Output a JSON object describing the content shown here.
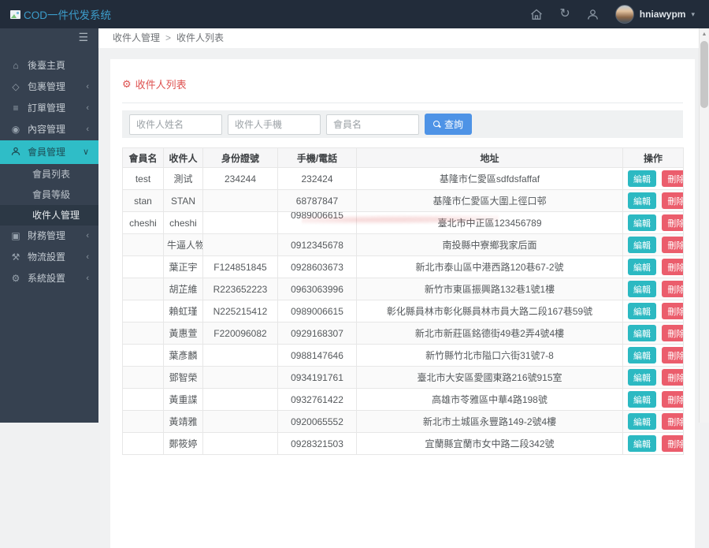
{
  "icons": {
    "hamburger": "☰",
    "home": "⌂",
    "gem": "◇",
    "layers": "≡",
    "ball": "◉",
    "money": "▣",
    "wrench": "⚒",
    "gear": "⚙",
    "chevron_left": "‹",
    "chevron_down": "∨",
    "caret_down": "▾",
    "refresh": "↻",
    "scroll_up": "▲",
    "title_gear": "⚙"
  },
  "colors": {
    "topbar_bg": "#222c3a",
    "sidebar_bg": "#364150",
    "active_item_bg": "#2fbdc7",
    "logo_text": "#3c9dcb",
    "title_red": "#de5250",
    "search_btn_blue": "#4e93e6",
    "edit_btn": "#2cb9c2",
    "delete_btn": "#eb5d6c"
  },
  "header": {
    "logo_text": "COD一件代发系统",
    "username": "hniawypm"
  },
  "sidebar": {
    "items": [
      {
        "label": "後臺主頁",
        "arrow": ""
      },
      {
        "label": "包裹管理",
        "arrow": "‹"
      },
      {
        "label": "訂單管理",
        "arrow": "‹"
      },
      {
        "label": "內容管理",
        "arrow": "‹"
      },
      {
        "label": "會員管理",
        "arrow": "∨"
      },
      {
        "label": "財務管理",
        "arrow": "‹"
      },
      {
        "label": "物流設置",
        "arrow": "‹"
      },
      {
        "label": "系統設置",
        "arrow": "‹"
      }
    ],
    "submenu": [
      {
        "label": "會員列表"
      },
      {
        "label": "會員等級"
      },
      {
        "label": "收件人管理"
      }
    ]
  },
  "breadcrumb": {
    "parent": "收件人管理",
    "separator": ">",
    "current": "收件人列表"
  },
  "page": {
    "title": "收件人列表"
  },
  "search": {
    "fields": [
      {
        "placeholder": "收件人姓名"
      },
      {
        "placeholder": "收件人手機"
      },
      {
        "placeholder": "會員名"
      }
    ],
    "button": "查詢"
  },
  "table": {
    "headers": [
      "會員名",
      "收件人",
      "身份證號",
      "手機/電話",
      "地址",
      "操作"
    ],
    "actions": {
      "edit": "編輯",
      "delete": "刪除"
    },
    "rows": [
      {
        "member": "test",
        "recipient": "測试",
        "id_number": "234244",
        "phone": "232424",
        "address": "基隆市仁愛區sdfdsfaffaf"
      },
      {
        "member": "stan",
        "recipient": "STAN",
        "id_number": "",
        "phone": "68787847",
        "address": "基隆市仁愛區大圍上徑口邨"
      },
      {
        "member": "cheshi",
        "recipient": "cheshi",
        "id_number": "",
        "phone": "0989006615",
        "address": "臺北市中正區123456789",
        "phone_raised": true,
        "watermark": true
      },
      {
        "member": "",
        "recipient": "牛逼人物",
        "id_number": "",
        "phone": "0912345678",
        "address": "南投縣中寮鄉我家后面"
      },
      {
        "member": "",
        "recipient": "葉正宇",
        "id_number": "F124851845",
        "phone": "0928603673",
        "address": "新北市泰山區中港西路120巷67-2號"
      },
      {
        "member": "",
        "recipient": "胡芷維",
        "id_number": "R223652223",
        "phone": "0963063996",
        "address": "新竹市東區振興路132巷1號1樓"
      },
      {
        "member": "",
        "recipient": "賴虹瑾",
        "id_number": "N225215412",
        "phone": "0989006615",
        "address": "彰化縣員林市彰化縣員林市員大路二段167巷59號"
      },
      {
        "member": "",
        "recipient": "黃惠萱",
        "id_number": "F220096082",
        "phone": "0929168307",
        "address": "新北市新莊區銘德街49巷2弄4號4樓"
      },
      {
        "member": "",
        "recipient": "葉彥麟",
        "id_number": "",
        "phone": "0988147646",
        "address": "新竹縣竹北市隘口六街31號7-8"
      },
      {
        "member": "",
        "recipient": "鄧智榮",
        "id_number": "",
        "phone": "0934191761",
        "address": "臺北市大安區愛國東路216號915室"
      },
      {
        "member": "",
        "recipient": "黃重諜",
        "id_number": "",
        "phone": "0932761422",
        "address": "高雄市苓雅區中華4路198號"
      },
      {
        "member": "",
        "recipient": "黃靖雅",
        "id_number": "",
        "phone": "0920065552",
        "address": "新北市土城區永豐路149-2號4樓"
      },
      {
        "member": "",
        "recipient": "鄭筱婷",
        "id_number": "",
        "phone": "0928321503",
        "address": "宜蘭縣宜蘭市女中路二段342號"
      }
    ]
  }
}
